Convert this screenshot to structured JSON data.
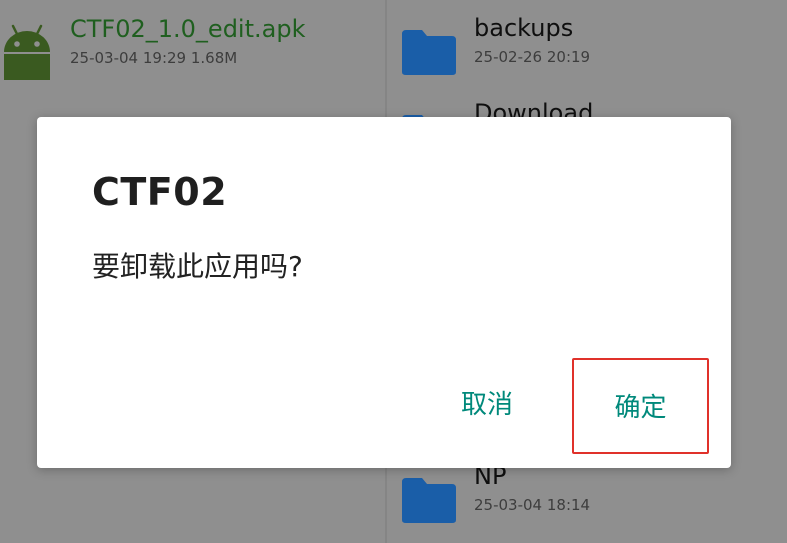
{
  "background": {
    "apk_item": {
      "name": "CTF02_1.0_edit.apk",
      "meta": "25-03-04 19:29  1.68M",
      "icon": "android-icon"
    },
    "folders": [
      {
        "name": "backups",
        "meta": "25-02-26 20:19",
        "icon": "folder-icon"
      },
      {
        "name": "Download",
        "meta": "",
        "icon": "folder-icon"
      },
      {
        "name": "NP",
        "meta": "25-03-04 18:14",
        "icon": "folder-icon"
      }
    ]
  },
  "dialog": {
    "title": "CTF02",
    "message": "要卸载此应用吗?",
    "cancel_label": "取消",
    "ok_label": "确定"
  },
  "colors": {
    "accent": "#00897b",
    "highlight": "#e0312a",
    "apk_name": "#1f5f1f",
    "folder": "#1a5ea8"
  }
}
